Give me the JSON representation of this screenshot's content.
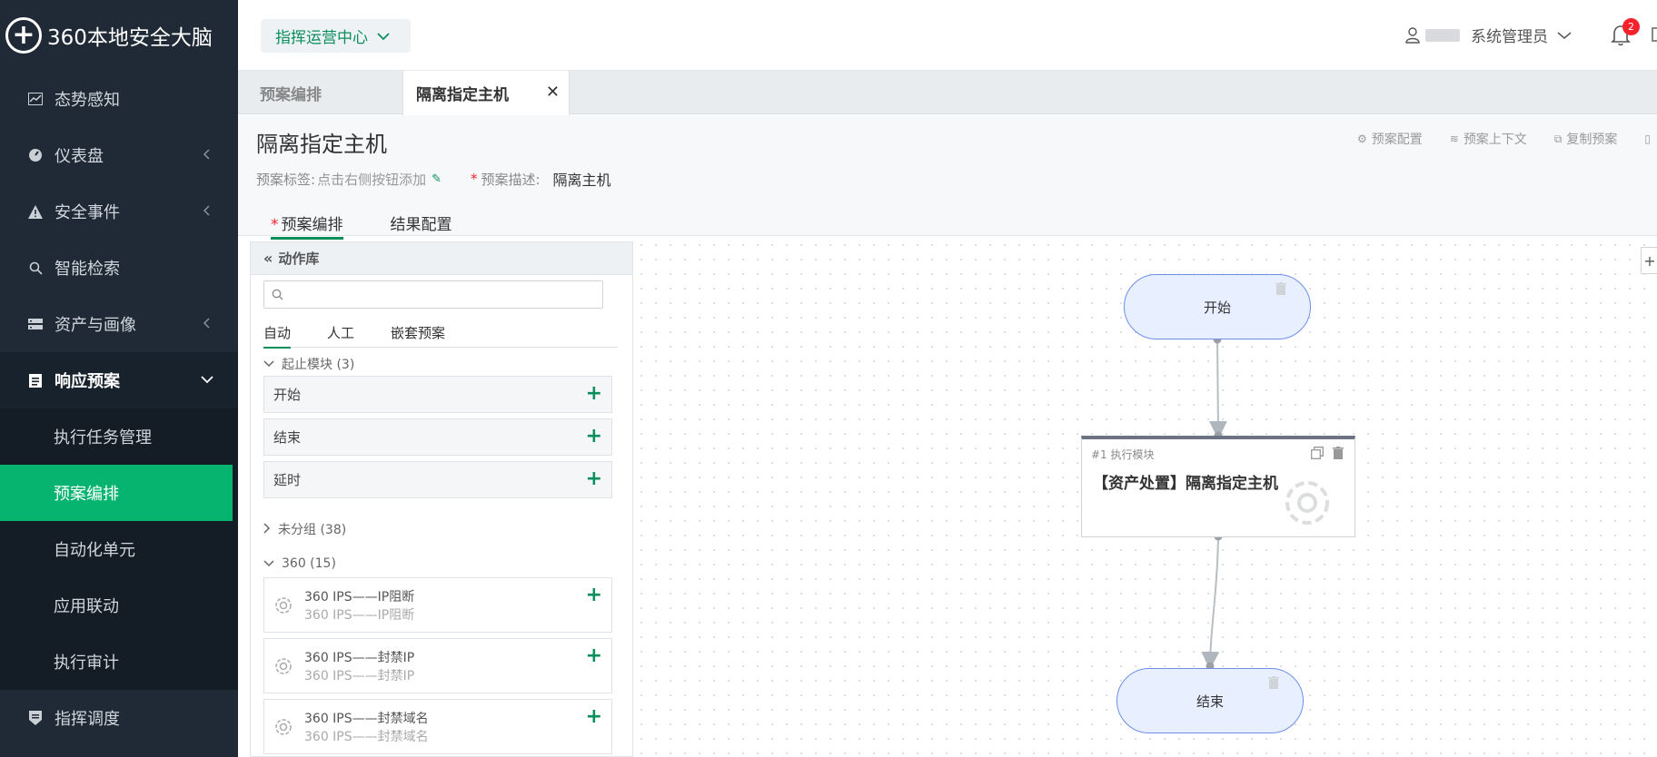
{
  "logo": {
    "text": "360本地安全大脑"
  },
  "sidebar": {
    "items": [
      {
        "label": "态势感知"
      },
      {
        "label": "仪表盘"
      },
      {
        "label": "安全事件"
      },
      {
        "label": "智能检索"
      },
      {
        "label": "资产与画像"
      },
      {
        "label": "响应预案"
      },
      {
        "label": "指挥调度"
      }
    ],
    "sub_items": [
      {
        "label": "执行任务管理"
      },
      {
        "label": "预案编排"
      },
      {
        "label": "自动化单元"
      },
      {
        "label": "应用联动"
      },
      {
        "label": "执行审计"
      }
    ]
  },
  "header": {
    "center_select": "指挥运营中心",
    "user_role": "系统管理员",
    "notifications": "2"
  },
  "tabs": [
    {
      "label": "预案编排"
    },
    {
      "label": "隔离指定主机"
    }
  ],
  "page": {
    "title": "隔离指定主机",
    "tag_label": "预案标签:",
    "tag_hint": "点击右侧按钮添加",
    "desc_req": "*",
    "desc_label": "预案描述:",
    "desc_value": "隔离主机",
    "actions": [
      {
        "label": "预案配置"
      },
      {
        "label": "预案上下文"
      },
      {
        "label": "复制预案"
      }
    ],
    "subtabs": [
      {
        "label": "预案编排",
        "req": "*"
      },
      {
        "label": "结果配置"
      }
    ]
  },
  "library": {
    "title": "动作库",
    "search_placeholder": "",
    "tabs": [
      {
        "label": "自动"
      },
      {
        "label": "人工"
      },
      {
        "label": "嵌套预案"
      }
    ],
    "groups": [
      {
        "label": "起止模块 (3)"
      },
      {
        "label": "未分组 (38)"
      },
      {
        "label": "360 (15)"
      }
    ],
    "start_items": [
      {
        "label": "开始"
      },
      {
        "label": "结束"
      },
      {
        "label": "延时"
      }
    ],
    "ips_items": [
      {
        "title": "360 IPS——IP阻断",
        "sub": "360 IPS——IP阻断"
      },
      {
        "title": "360 IPS——封禁IP",
        "sub": "360 IPS——封禁IP"
      },
      {
        "title": "360 IPS——封禁域名",
        "sub": "360 IPS——封禁域名"
      }
    ]
  },
  "canvas": {
    "start_node": "开始",
    "exec_node_label": "#1 执行模块",
    "exec_node_title": "【资产处置】隔离指定主机",
    "end_node": "结束"
  },
  "colors": {
    "sidebar_bg": "#1f2a36",
    "accent_green": "#07b46f",
    "node_fill": "#e8efff",
    "node_border": "#6d8fe8",
    "badge_red": "#f5222d"
  }
}
